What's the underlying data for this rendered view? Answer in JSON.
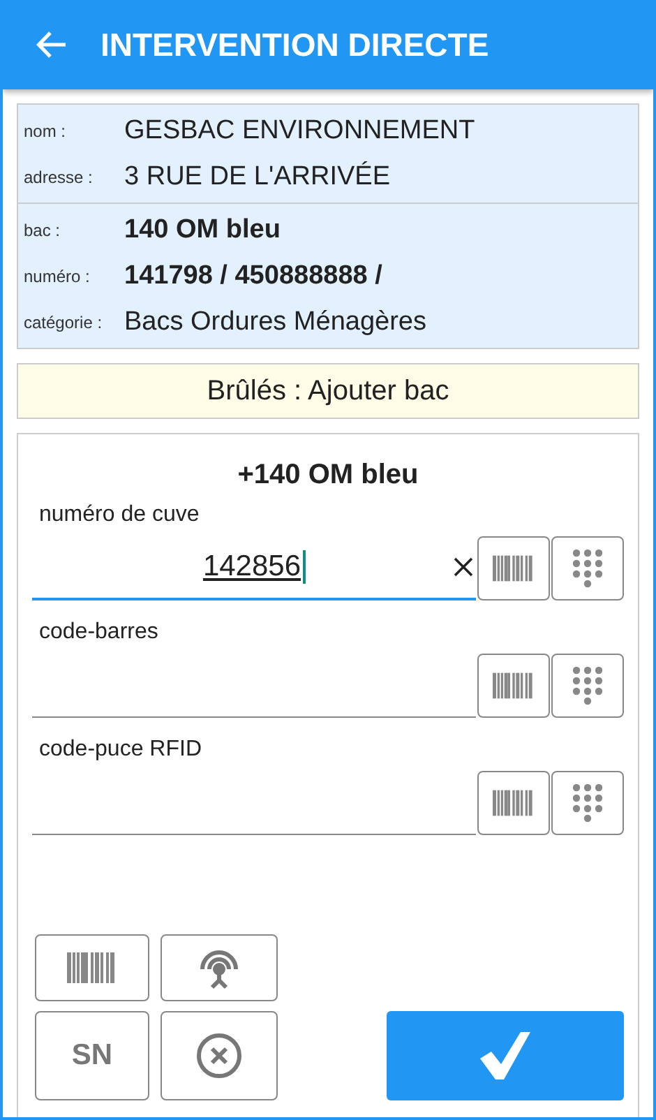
{
  "app_bar": {
    "title": "INTERVENTION DIRECTE"
  },
  "info_groups": [
    {
      "rows": [
        {
          "label": "nom :",
          "value": "GESBAC ENVIRONNEMENT",
          "bold": false
        },
        {
          "label": "adresse :",
          "value": "3 RUE DE L'ARRIVÉE",
          "bold": false
        }
      ]
    },
    {
      "rows": [
        {
          "label": "bac :",
          "value": "140 OM bleu",
          "bold": true
        },
        {
          "label": "numéro :",
          "value": "141798 / 450888888 /",
          "bold": true
        },
        {
          "label": "catégorie :",
          "value": "Bacs Ordures Ménagères",
          "bold": false
        }
      ]
    }
  ],
  "banner": "Brûlés : Ajouter bac",
  "form": {
    "title": "+140 OM bleu",
    "fields": [
      {
        "label": "numéro de cuve",
        "value": "142856",
        "focused": true
      },
      {
        "label": "code-barres",
        "focused": false
      },
      {
        "label": "code-puce RFID",
        "focused": false
      }
    ],
    "tools": [
      {
        "kind": "barcode"
      },
      {
        "kind": "rfid"
      },
      {
        "kind": "text",
        "label": "SN"
      },
      {
        "kind": "cancel"
      }
    ]
  }
}
